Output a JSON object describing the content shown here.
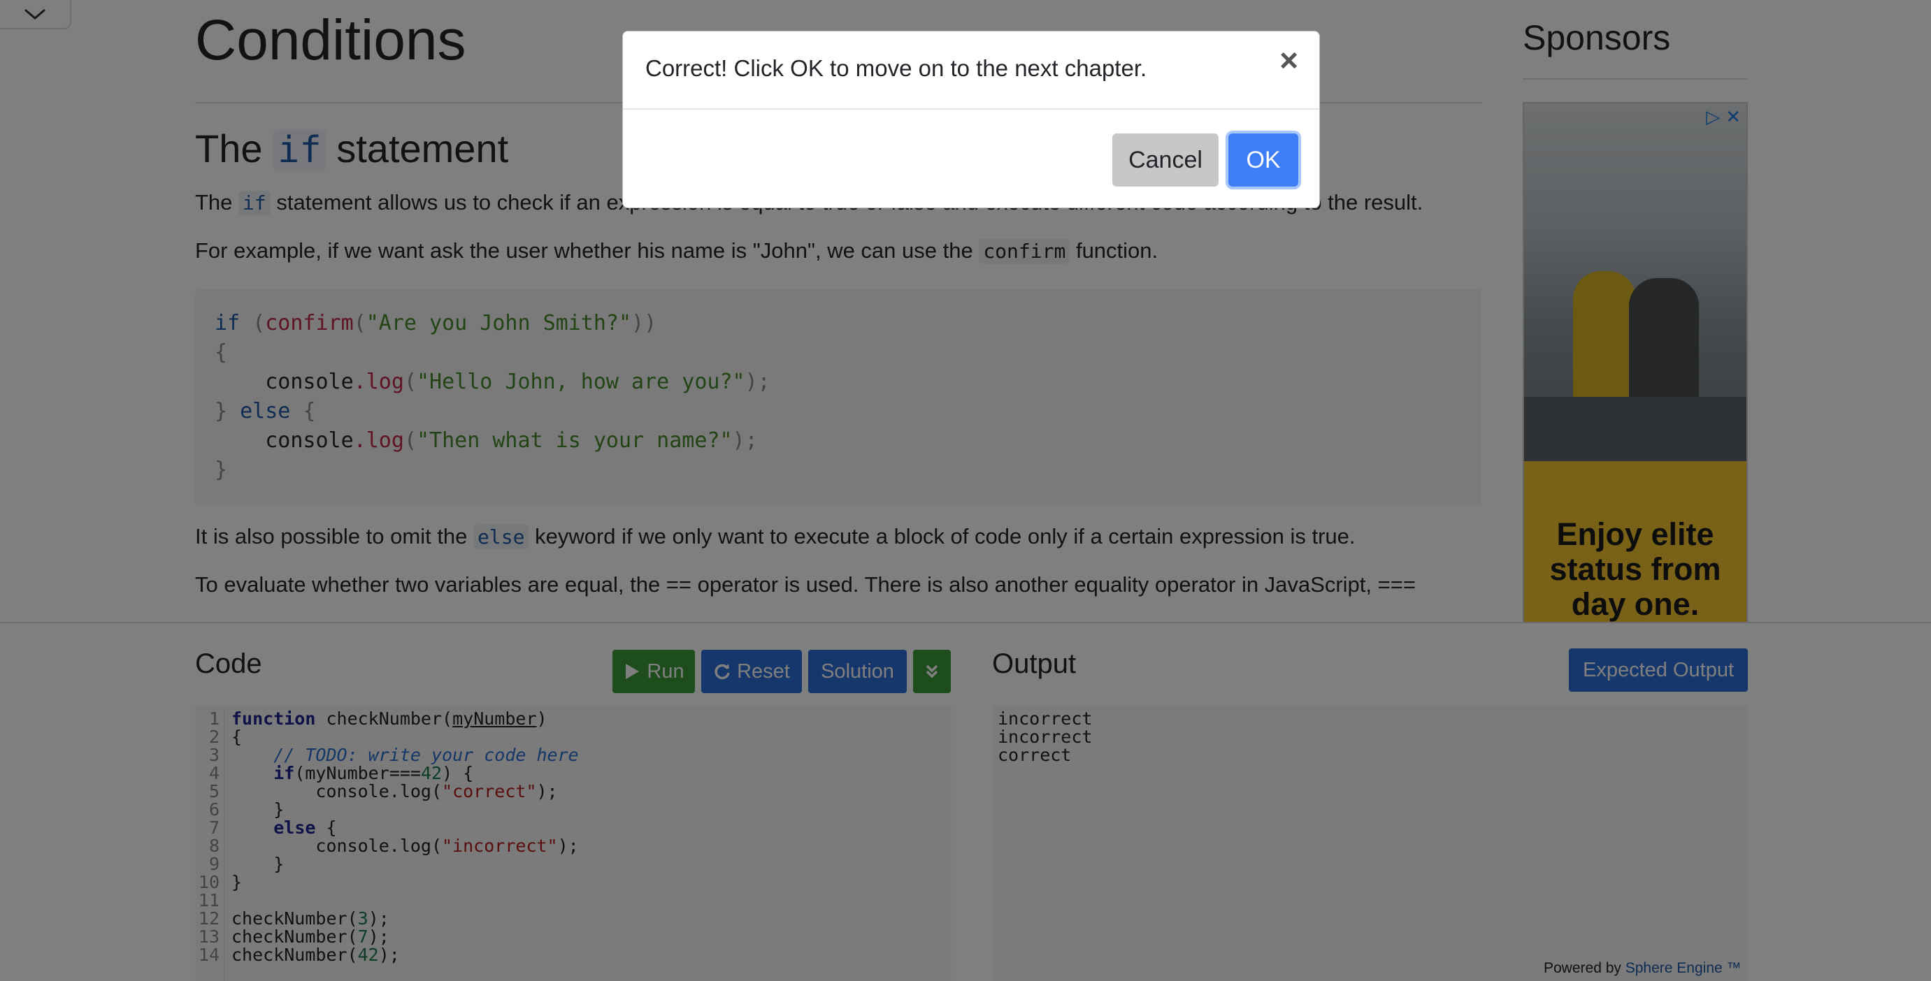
{
  "content": {
    "page_title": "Conditions",
    "section_title_pre": "The ",
    "section_title_code": "if",
    "section_title_post": " statement",
    "para1_pre": "The ",
    "para1_code": "if",
    "para1_post": " statement allows us to check if an expression is equal to true or false and execute different code according to the result.",
    "para2_pre": "For example, if we want ask the user whether his name is \"John\", we can use the ",
    "para2_code": "confirm",
    "para2_post": " function.",
    "para3_pre": "It is also possible to omit the ",
    "para3_code": "else",
    "para3_post": " keyword if we only want to execute a block of code only if a certain expression is true.",
    "para4": "To evaluate whether two variables are equal, the == operator is used. There is also another equality operator in JavaScript, ==="
  },
  "sponsors": {
    "title": "Sponsors",
    "ad_text": "Enjoy elite status from day one.",
    "ad_icon_play": "▷",
    "ad_icon_close": "✕"
  },
  "code_panel": {
    "title": "Code",
    "run_label": "Run",
    "reset_label": "Reset",
    "solution_label": "Solution",
    "line_numbers": "1\n2\n3\n4\n5\n6\n7\n8\n9\n10\n11\n12\n13\n14"
  },
  "output_panel": {
    "title": "Output",
    "expected_label": "Expected Output",
    "output_text": "incorrect\nincorrect\ncorrect",
    "powered_by": "Powered by ",
    "powered_link": "Sphere Engine ™"
  },
  "modal": {
    "message": "Correct! Click OK to move on to the next chapter.",
    "close": "×",
    "cancel_label": "Cancel",
    "ok_label": "OK"
  },
  "colors": {
    "run_green": "#3a9b3a",
    "button_blue": "#2d6fd8",
    "ok_blue": "#3d7ef7",
    "ad_yellow": "#f2c430"
  }
}
